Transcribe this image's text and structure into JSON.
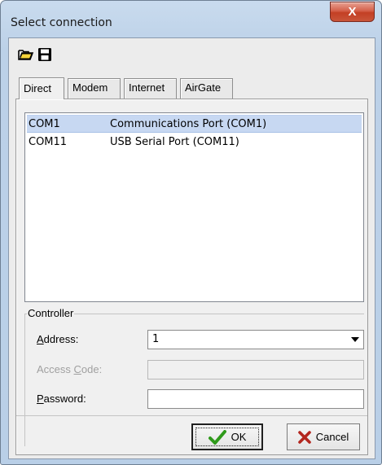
{
  "window": {
    "title": "Select connection",
    "close_glyph": "X"
  },
  "toolbar": {
    "icons": [
      "folder-open-icon",
      "floppy-save-icon"
    ]
  },
  "tabs": [
    {
      "label": "Direct",
      "active": true
    },
    {
      "label": "Modem",
      "active": false
    },
    {
      "label": "Internet",
      "active": false
    },
    {
      "label": "AirGate",
      "active": false
    }
  ],
  "connections": [
    {
      "port": "COM1",
      "description": "Communications Port (COM1)",
      "selected": true
    },
    {
      "port": "COM11",
      "description": "USB Serial Port (COM11)",
      "selected": false
    }
  ],
  "controller": {
    "legend": "Controller",
    "address": {
      "label_accel": "A",
      "label_rest": "ddress:",
      "value": "1"
    },
    "access_code": {
      "label_pre": "Access ",
      "label_accel": "C",
      "label_rest": "ode:",
      "value": ""
    },
    "password": {
      "label_accel": "P",
      "label_rest": "assword:",
      "value": ""
    }
  },
  "buttons": {
    "ok": "OK",
    "cancel": "Cancel"
  },
  "colors": {
    "selection": "#c7d8f2",
    "close": "#c9553a",
    "ok_check": "#2f9a1b",
    "cancel_x": "#b3261e"
  }
}
